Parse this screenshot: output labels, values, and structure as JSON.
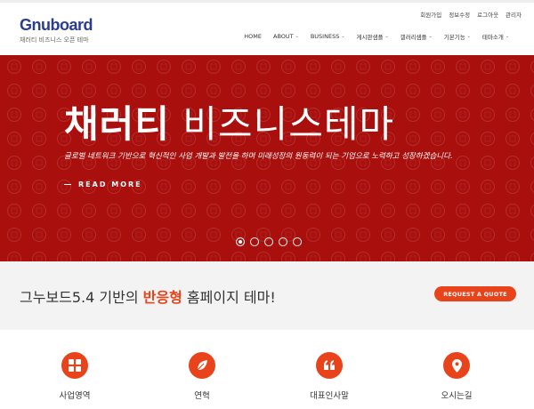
{
  "brand": {
    "logo": "Gnuboard",
    "tagline": "채러티 비즈니스 오픈 테마"
  },
  "util_links": [
    "회원가입",
    "정보수정",
    "로그아웃",
    "관리자"
  ],
  "nav": [
    {
      "label": "HOME",
      "has_caret": false
    },
    {
      "label": "ABOUT",
      "has_caret": true
    },
    {
      "label": "BUSINESS",
      "has_caret": true
    },
    {
      "label": "게시판샘플",
      "has_caret": true
    },
    {
      "label": "갤러리샘플",
      "has_caret": true
    },
    {
      "label": "기본기능",
      "has_caret": true
    },
    {
      "label": "테마소개",
      "has_caret": true
    }
  ],
  "hero": {
    "title_bold": "채러티",
    "title_light": "비즈니스테마",
    "description": "글로벌 네트워크 기반으로 혁신적인 사업 개발과 발전을 하며 미래성장의 원동력이 되는 기업으로 노력하고 성장하겠습니다.",
    "read_more": "READ MORE",
    "slide_count": 5,
    "active_slide": 1,
    "bg_color": "#a90f0d"
  },
  "cta": {
    "text_before": "그누보드5.4 기반의 ",
    "text_highlight": "반응형",
    "text_after": " 홈페이지 테마!",
    "button": "REQUEST A QUOTE",
    "accent": "#e8431b"
  },
  "features": [
    {
      "label": "사업영역",
      "icon": "grid-icon"
    },
    {
      "label": "연혁",
      "icon": "leaf-icon"
    },
    {
      "label": "대표인사말",
      "icon": "quote-icon"
    },
    {
      "label": "오시는길",
      "icon": "map-pin-icon"
    }
  ]
}
